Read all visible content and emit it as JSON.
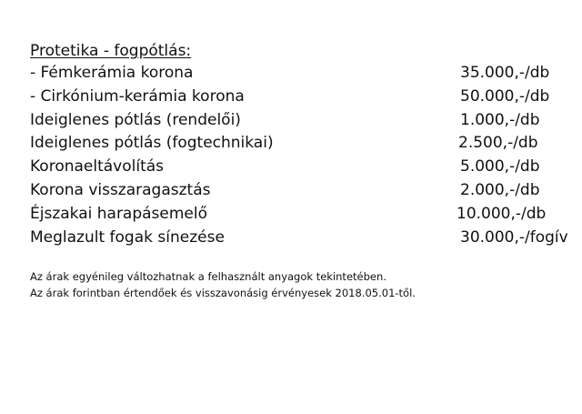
{
  "section": {
    "title": "Protetika - fogpótlás:"
  },
  "items": [
    {
      "name": "- Fémkerámia korona",
      "price": "35.000,-/db"
    },
    {
      "name": "- Cirkónium-kerámia korona",
      "price": "50.000,-/db"
    },
    {
      "name": "Ideiglenes pótlás (rendelői)",
      "price": "1.000,-/db"
    },
    {
      "name": "Ideiglenes pótlás (fogtechnikai)",
      "price": "2.500,-/db"
    },
    {
      "name": "Koronaeltávolítás",
      "price": "5.000,-/db"
    },
    {
      "name": "Korona visszaragasztás",
      "price": "2.000,-/db"
    },
    {
      "name": "Éjszakai harapásemelő",
      "price": "10.000,-/db"
    },
    {
      "name": "Meglazult fogak sínezése",
      "price": "30.000,-/fogív"
    }
  ],
  "notes": [
    "Az árak egyénileg változhatnak a felhasznált anyagok tekintetében.",
    "Az árak forintban értendőek és visszavonásig érvényesek 2018.05.01-től."
  ]
}
